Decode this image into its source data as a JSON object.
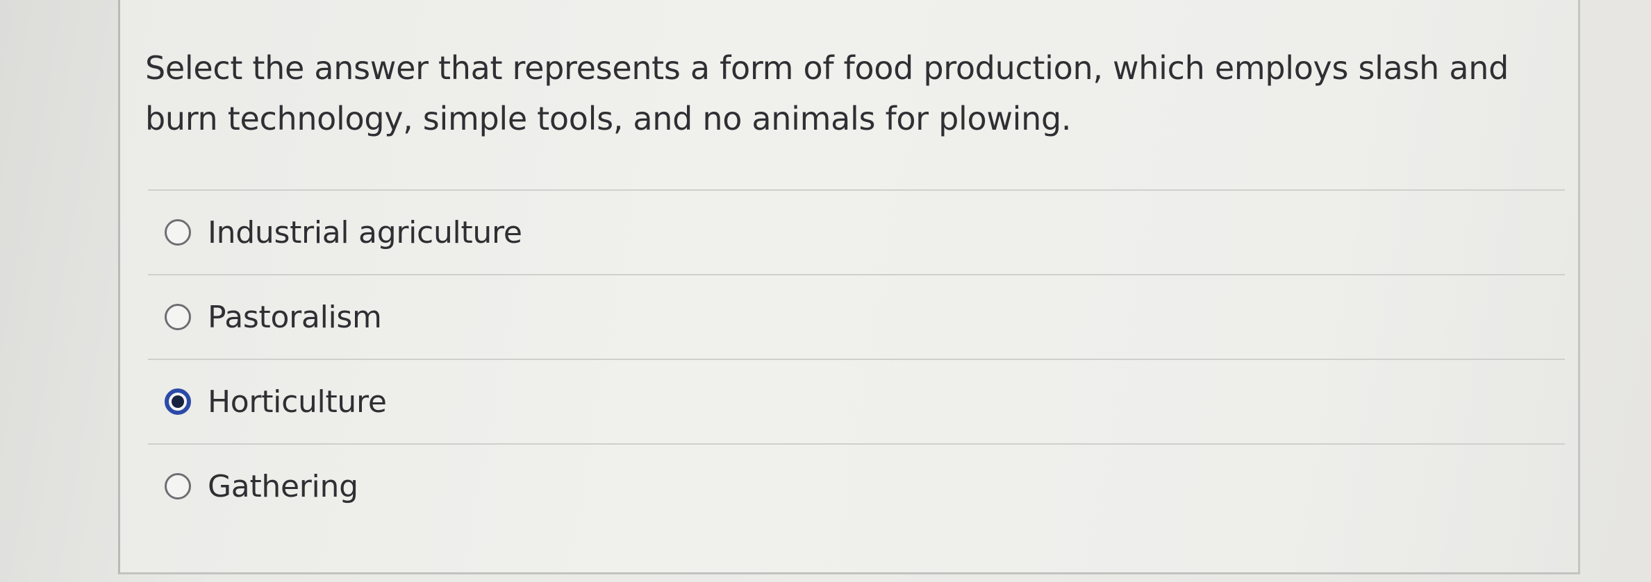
{
  "question": {
    "text": "Select the answer that represents a form of food production, which employs slash and burn technology, simple tools, and no animals for plowing."
  },
  "options": [
    {
      "label": "Industrial agriculture",
      "selected": false
    },
    {
      "label": "Pastoralism",
      "selected": false
    },
    {
      "label": "Horticulture",
      "selected": true
    },
    {
      "label": "Gathering",
      "selected": false
    }
  ],
  "colors": {
    "selected_radio": "#2b4aa8",
    "text": "#2f2f33"
  }
}
